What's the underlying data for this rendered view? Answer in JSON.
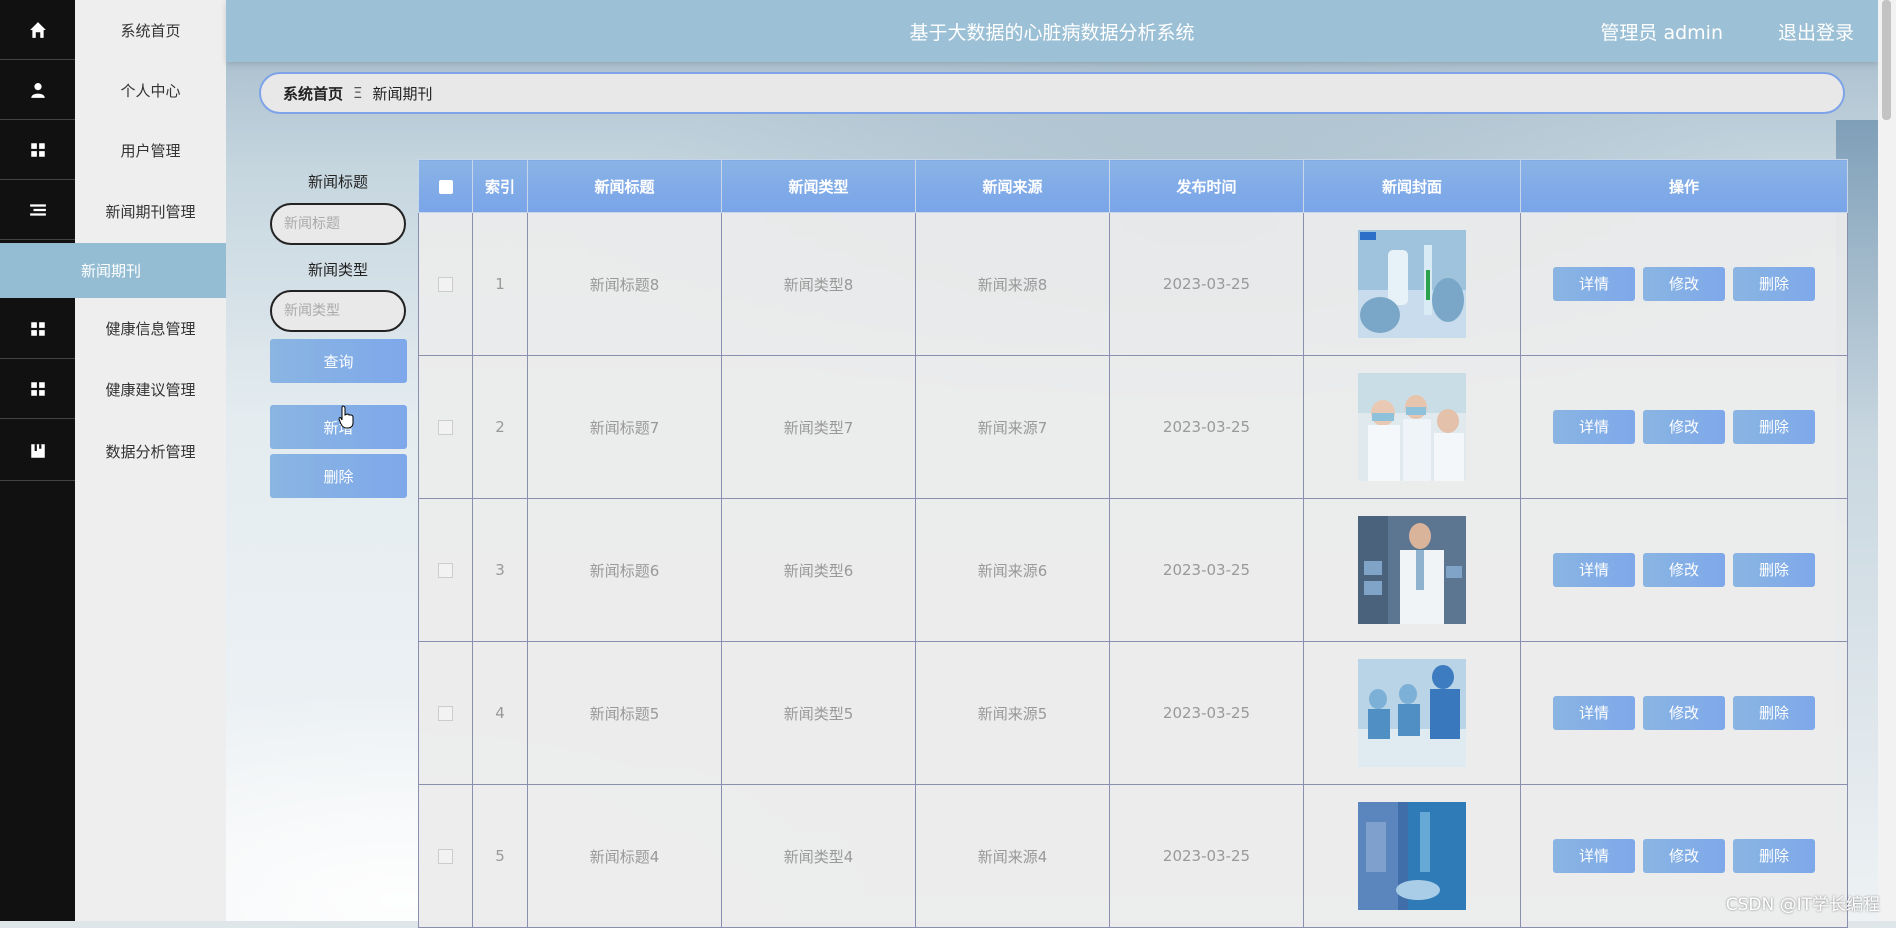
{
  "app": {
    "title": "基于大数据的心脏病数据分析系统",
    "user_label": "管理员 admin",
    "logout_label": "退出登录"
  },
  "sidebar": {
    "items": [
      {
        "label": "系统首页",
        "icon": "home-icon"
      },
      {
        "label": "个人中心",
        "icon": "user-icon"
      },
      {
        "label": "用户管理",
        "icon": "grid-icon"
      },
      {
        "label": "新闻期刊管理",
        "icon": "list-icon"
      },
      {
        "label": "健康信息管理",
        "icon": "grid-icon"
      },
      {
        "label": "健康建议管理",
        "icon": "grid-icon"
      },
      {
        "label": "数据分析管理",
        "icon": "chart-icon"
      }
    ],
    "active_sub": "新闻期刊"
  },
  "breadcrumb": {
    "home": "系统首页",
    "separator": "Ξ",
    "current": "新闻期刊"
  },
  "search": {
    "title_label": "新闻标题",
    "title_placeholder": "新闻标题",
    "title_value": "",
    "type_label": "新闻类型",
    "type_placeholder": "新闻类型",
    "type_value": "",
    "query_label": "查询",
    "add_label": "新增",
    "delete_label": "删除"
  },
  "table": {
    "columns": [
      "索引",
      "新闻标题",
      "新闻类型",
      "新闻来源",
      "发布时间",
      "新闻封面",
      "操作"
    ],
    "rows": [
      {
        "index": "1",
        "title": "新闻标题8",
        "type": "新闻类型8",
        "source": "新闻来源8",
        "date": "2023-03-25"
      },
      {
        "index": "2",
        "title": "新闻标题7",
        "type": "新闻类型7",
        "source": "新闻来源7",
        "date": "2023-03-25"
      },
      {
        "index": "3",
        "title": "新闻标题6",
        "type": "新闻类型6",
        "source": "新闻来源6",
        "date": "2023-03-25"
      },
      {
        "index": "4",
        "title": "新闻标题5",
        "type": "新闻类型5",
        "source": "新闻来源5",
        "date": "2023-03-25"
      },
      {
        "index": "5",
        "title": "新闻标题4",
        "type": "新闻类型4",
        "source": "新闻来源4",
        "date": "2023-03-25"
      }
    ],
    "actions": {
      "detail": "详情",
      "edit": "修改",
      "delete": "删除"
    }
  },
  "watermark": "CSDN @IT学长编程",
  "colors": {
    "header_bg": "#9cc0d5",
    "rail_bg": "#111111",
    "active_menu_bg": "#94bdd4",
    "button_gradient_start": "#8ab5e2",
    "button_gradient_end": "#7ea8ea"
  }
}
